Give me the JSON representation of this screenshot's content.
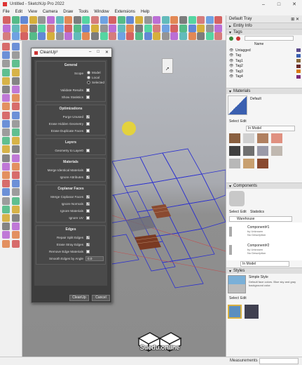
{
  "window": {
    "title": "Untitled - SketchUp Pro 2022"
  },
  "menu": [
    "File",
    "Edit",
    "View",
    "Camera",
    "Draw",
    "Tools",
    "Window",
    "Extensions",
    "Help"
  ],
  "statusbar": {
    "measurements_label": "Measurements"
  },
  "tray": {
    "title": "Default Tray",
    "entity_info": "Entity Info",
    "tags_section": "Tags",
    "tags_header_name": "Name",
    "tags": [
      {
        "name": "Untagged",
        "color": "#5b4a8a"
      },
      {
        "name": "Tag",
        "color": "#3a5fb0"
      },
      {
        "name": "Tag1",
        "color": "#8a6a3a"
      },
      {
        "name": "Tag2",
        "color": "#6a2a2a"
      },
      {
        "name": "Tag3",
        "color": "#d97a10"
      },
      {
        "name": "Tag4",
        "color": "#7a2a7a"
      }
    ],
    "materials_section": "Materials",
    "materials_default": "Default",
    "materials_tabs": [
      "Select",
      "Edit"
    ],
    "materials_dropdown": "In Model",
    "components_section": "Components",
    "components_tabs": [
      "Select",
      "Edit",
      "Statistics"
    ],
    "components_search": "Warehouse",
    "components": [
      {
        "name": "Component#1",
        "by": "by Unknown",
        "desc": "No Description"
      },
      {
        "name": "Component#2",
        "by": "by Unknown",
        "desc": "No Description"
      }
    ],
    "components_dropdown": "In Model",
    "styles_section": "Styles",
    "style_name": "Simple Style",
    "style_desc": "Default face colors. Blue sky and gray background color.",
    "styles_tabs": [
      "Select",
      "Edit"
    ]
  },
  "dialog": {
    "title": "CleanUp³",
    "groups": {
      "general": "General",
      "optimizations": "Optimizations",
      "layers": "Layers",
      "materials": "Materials",
      "coplanar": "Coplanar Faces",
      "edges": "Edges"
    },
    "scope_label": "Scope",
    "scope_options": [
      "Model",
      "Local",
      "Selected"
    ],
    "general_rows": [
      "Validate Results",
      "Show Statistics"
    ],
    "optimization_rows": [
      "Purge Unused",
      "Erase Hidden Geometry",
      "Erase Duplicate Faces"
    ],
    "layers_rows": [
      "Geometry to Layer0"
    ],
    "materials_rows": [
      "Merge Identical Materials",
      "Ignore Attributes"
    ],
    "coplanar_rows": [
      "Merge Coplanar Faces",
      "Ignore Normals",
      "Ignore Materials",
      "Ignore UV"
    ],
    "edges_rows": [
      "Repair Split Edges",
      "Erase Stray Edges",
      "Remove Edge Materials",
      "Smooth Edges by Angle"
    ],
    "smooth_angle": "0.0",
    "cleanup_button": "CleanUp",
    "cancel_button": "Cancel"
  },
  "watermark": "Suedu.online",
  "colors": {
    "highlight": "#e21f1f",
    "cursor": "#ecd828",
    "grid_line": "#2a2fd0"
  }
}
